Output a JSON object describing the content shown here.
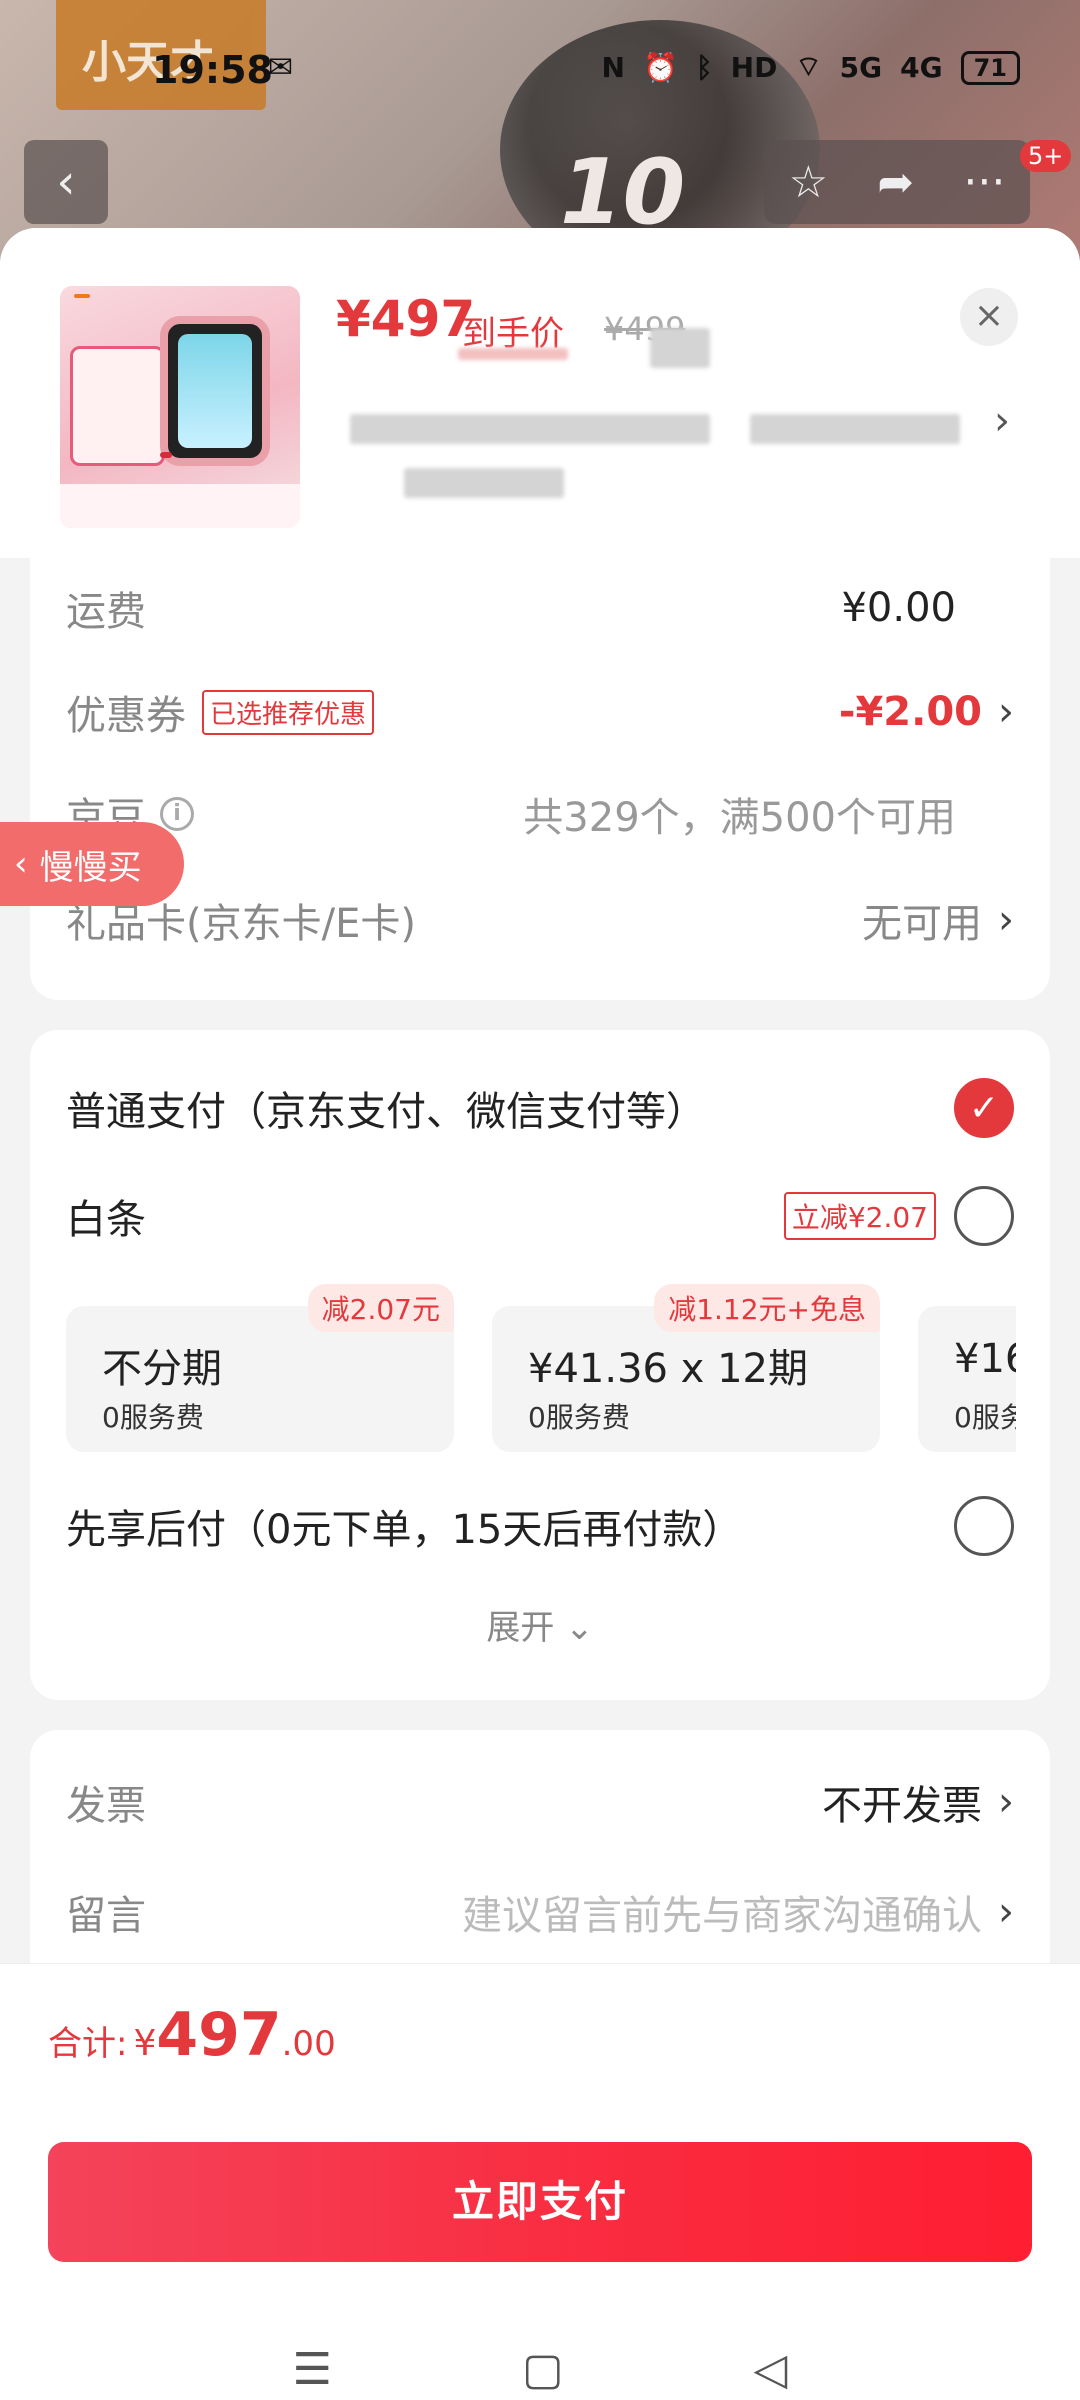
{
  "status_bar": {
    "time": "19:58",
    "battery": "71",
    "network": [
      "5G",
      "4G"
    ],
    "icons": [
      "wechat-icon",
      "nfc-icon",
      "alarm-icon",
      "bluetooth-icon",
      "hd-icon",
      "wifi-icon",
      "signal-icon",
      "battery-icon"
    ]
  },
  "background_page": {
    "brand_text": "小天才",
    "badge": "5+",
    "watch_text": "10"
  },
  "product": {
    "price": "¥497",
    "price_label": "到手价",
    "original_price": "¥499"
  },
  "fees": {
    "shipping_label": "运费",
    "shipping_value": "¥0.00",
    "coupon_label": "优惠券",
    "coupon_tag": "已选推荐优惠",
    "coupon_value": "-¥2.00",
    "jd_beans_label": "京豆",
    "jd_beans_value": "共329个，满500个可用",
    "gift_card_label": "礼品卡(京东卡/E卡)",
    "gift_card_value": "无可用"
  },
  "slow_buy": "慢慢买",
  "payment": {
    "normal_label": "普通支付（京东支付、微信支付等）",
    "normal_checked": true,
    "baitiao_label": "白条",
    "baitiao_tag": "立减¥2.07",
    "plans": [
      {
        "title": "不分期",
        "sub": "0服务费",
        "badge": "减2.07元"
      },
      {
        "title": "¥41.36 x 12期",
        "sub": "0服务费",
        "badge": "减1.12元+免息"
      },
      {
        "title": "¥16",
        "sub": "0服务费",
        "badge": ""
      }
    ],
    "later_label": "先享后付（0元下单，15天后再付款）",
    "expand": "展开"
  },
  "invoice": {
    "invoice_label": "发票",
    "invoice_value": "不开发票",
    "note_label": "留言",
    "note_placeholder": "建议留言前先与商家沟通确认"
  },
  "bottom": {
    "total_label": "合计:",
    "total_yen": "¥",
    "total_int": "497",
    "total_dec": ".00",
    "pay_button": "立即支付"
  },
  "colors": {
    "accent": "#e4393c",
    "button": "#fa2a3e"
  }
}
